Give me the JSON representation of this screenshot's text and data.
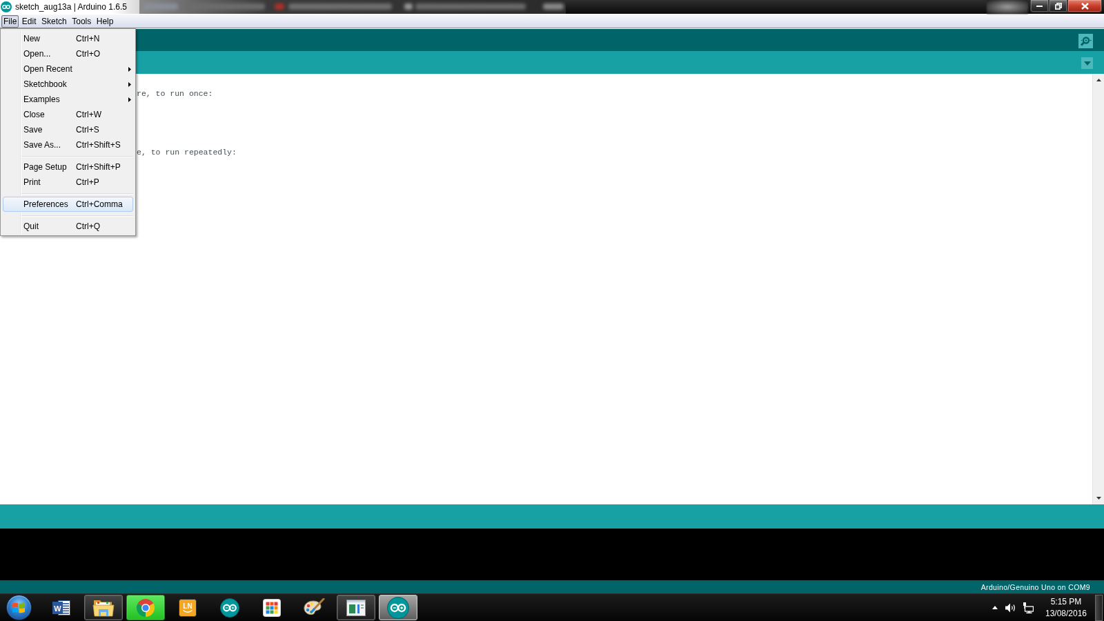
{
  "window": {
    "title": "sketch_aug13a | Arduino 1.6.5"
  },
  "menu_bar": [
    {
      "label": "File",
      "selected": true
    },
    {
      "label": "Edit",
      "selected": false
    },
    {
      "label": "Sketch",
      "selected": false
    },
    {
      "label": "Tools",
      "selected": false
    },
    {
      "label": "Help",
      "selected": false
    }
  ],
  "file_menu": {
    "items": [
      {
        "kind": "item",
        "label": "New",
        "shortcut": "Ctrl+N",
        "submenu": false,
        "selected": false
      },
      {
        "kind": "item",
        "label": "Open...",
        "shortcut": "Ctrl+O",
        "submenu": false,
        "selected": false
      },
      {
        "kind": "item",
        "label": "Open Recent",
        "submenu": true,
        "selected": false
      },
      {
        "kind": "item",
        "label": "Sketchbook",
        "submenu": true,
        "selected": false
      },
      {
        "kind": "item",
        "label": "Examples",
        "submenu": true,
        "selected": false
      },
      {
        "kind": "item",
        "label": "Close",
        "shortcut": "Ctrl+W",
        "submenu": false,
        "selected": false
      },
      {
        "kind": "item",
        "label": "Save",
        "shortcut": "Ctrl+S",
        "submenu": false,
        "selected": false
      },
      {
        "kind": "item",
        "label": "Save As...",
        "shortcut": "Ctrl+Shift+S",
        "submenu": false,
        "selected": false
      },
      {
        "kind": "separator"
      },
      {
        "kind": "item",
        "label": "Page Setup",
        "shortcut": "Ctrl+Shift+P",
        "submenu": false,
        "selected": false
      },
      {
        "kind": "item",
        "label": "Print",
        "shortcut": "Ctrl+P",
        "submenu": false,
        "selected": false
      },
      {
        "kind": "separator"
      },
      {
        "kind": "item",
        "label": "Preferences",
        "shortcut": "Ctrl+Comma",
        "submenu": false,
        "selected": true
      },
      {
        "kind": "separator"
      },
      {
        "kind": "item",
        "label": "Quit",
        "shortcut": "Ctrl+Q",
        "submenu": false,
        "selected": false
      }
    ]
  },
  "editor": {
    "lines": [
      "re, to run once:",
      "e, to run repeatedly:"
    ]
  },
  "status_bar": {
    "board": "Arduino/Genuino Uno on COM9"
  },
  "taskbar": {
    "apps": [
      {
        "icon_text": "W",
        "running": false,
        "flashing": false,
        "selected": false
      },
      {
        "running": true,
        "flashing": false,
        "selected": false
      },
      {
        "running": true,
        "flashing": true,
        "selected": false
      },
      {
        "icon_text": "LN",
        "running": false,
        "flashing": false,
        "selected": false
      },
      {
        "running": false,
        "flashing": false,
        "selected": false
      },
      {
        "running": false,
        "flashing": false,
        "selected": false
      },
      {
        "running": false,
        "flashing": false,
        "selected": false
      },
      {
        "running": true,
        "flashing": false,
        "selected": false
      },
      {
        "running": true,
        "flashing": false,
        "selected": true
      }
    ],
    "clock": {
      "time": "5:15 PM",
      "date": "13/08/2016"
    }
  }
}
